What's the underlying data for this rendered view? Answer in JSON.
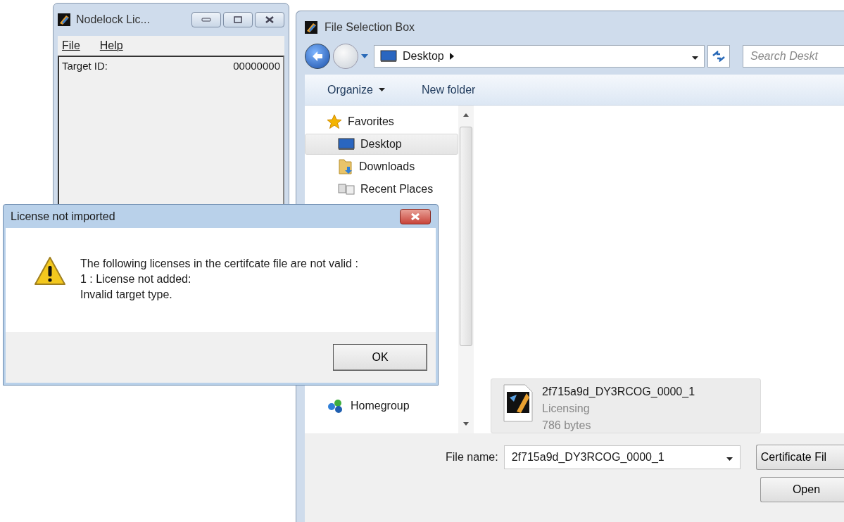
{
  "nodelock_window": {
    "title": "Nodelock Lic...",
    "menu": [
      {
        "label": "File"
      },
      {
        "label": "Help"
      }
    ],
    "fields": [
      {
        "label": "Target ID:",
        "value": "00000000"
      }
    ]
  },
  "file_dialog": {
    "title": "File Selection Box",
    "address": "Desktop",
    "search": {
      "placeholder": "Search Deskt"
    },
    "toolbar": [
      {
        "label": "Organize",
        "kind": "menu"
      },
      {
        "label": "New folder",
        "kind": "button"
      }
    ],
    "nav": [
      {
        "label": "Favorites",
        "kind": "favorites",
        "selected": false
      },
      {
        "label": "Desktop",
        "kind": "desktop",
        "selected": true
      },
      {
        "label": "Downloads",
        "kind": "downloads",
        "selected": false
      },
      {
        "label": "Recent Places",
        "kind": "recent",
        "selected": false
      },
      {
        "label": "Homegroup",
        "kind": "homegroup",
        "selected": false
      }
    ],
    "files": [
      {
        "name": "2f715a9d_DY3RCOG_0000_1",
        "type": "Licensing",
        "size": "786 bytes"
      }
    ],
    "file_name": {
      "label": "File name:",
      "value": "2f715a9d_DY3RCOG_0000_1"
    },
    "filter": "Certificate Fil",
    "buttons": [
      "Open"
    ]
  },
  "message_box": {
    "title": "License not imported",
    "lines": [
      "The following licenses in the certifcate file are not valid :",
      "1 : License not added:",
      "Invalid target type."
    ],
    "buttons": [
      "OK"
    ]
  }
}
